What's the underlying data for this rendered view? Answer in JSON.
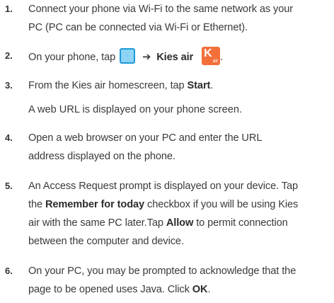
{
  "steps": [
    {
      "number": "1.",
      "lines": [
        "Connect your phone via Wi-Fi to the same network as your",
        "PC (PC can be connected via Wi-Fi or Ethernet)."
      ]
    },
    {
      "number": "2.",
      "prefix": "On your phone, tap",
      "arrow": "➔",
      "bold": "Kies air",
      "suffix": ".",
      "icons": [
        "apps-grid-icon",
        "kies-air-app-icon"
      ],
      "kies_icon_letter": "K",
      "kies_icon_text": "air"
    },
    {
      "number": "3.",
      "prefix": "From the Kies air homescreen, tap ",
      "bold": "Start",
      "suffix": ".",
      "note": "A web URL is displayed on your phone screen."
    },
    {
      "number": "4.",
      "lines": [
        "Open a web browser on your PC and enter the URL",
        "address displayed on the phone."
      ]
    },
    {
      "number": "5.",
      "line1": "An Access Request prompt is displayed on your device. Tap",
      "line2_prefix": "the ",
      "line2_bold": "Remember for today",
      "line2_suffix": " checkbox if you will be using Kies",
      "line3_prefix": "air with the same PC later.Tap ",
      "line3_bold": "Allow",
      "line3_suffix": " to permit connection",
      "line4": "between the computer and device."
    },
    {
      "number": "6.",
      "line1": "On your PC, you may be prompted to acknowledge that the",
      "line2_prefix": "page to be opened uses Java. Click ",
      "line2_bold": "OK",
      "line2_suffix": "."
    }
  ],
  "colors": {
    "text": "#3a3a3a",
    "apps_icon": "#1f9bd8",
    "kies_icon": "#f36f3a"
  }
}
